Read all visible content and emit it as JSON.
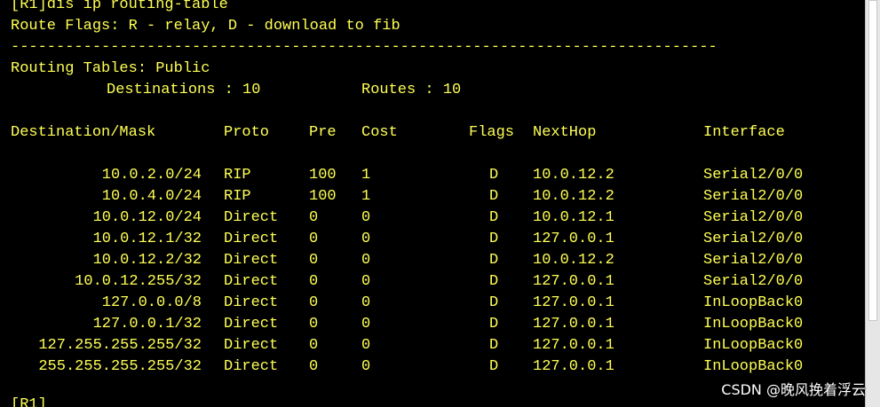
{
  "terminal": {
    "command_line": "[R1]dis ip routing-table",
    "flags_line": "Route Flags: R - relay, D - download to fib",
    "separator": "------------------------------------------------------------------------------",
    "table_name": "Routing Tables: Public",
    "destinations_label": "Destinations : 10",
    "routes_label": "Routes : 10",
    "headers": {
      "dest": "Destination/Mask",
      "proto": "Proto",
      "pre": "Pre",
      "cost": "Cost",
      "flags": "Flags",
      "nexthop": "NextHop",
      "iface": "Interface"
    },
    "rows": [
      {
        "dest": "10.0.2.0/24",
        "proto": "RIP",
        "pre": "100",
        "cost": "1",
        "flags": "D",
        "nexthop": "10.0.12.2",
        "iface": "Serial2/0/0"
      },
      {
        "dest": "10.0.4.0/24",
        "proto": "RIP",
        "pre": "100",
        "cost": "1",
        "flags": "D",
        "nexthop": "10.0.12.2",
        "iface": "Serial2/0/0"
      },
      {
        "dest": "10.0.12.0/24",
        "proto": "Direct",
        "pre": "0",
        "cost": "0",
        "flags": "D",
        "nexthop": "10.0.12.1",
        "iface": "Serial2/0/0"
      },
      {
        "dest": "10.0.12.1/32",
        "proto": "Direct",
        "pre": "0",
        "cost": "0",
        "flags": "D",
        "nexthop": "127.0.0.1",
        "iface": "Serial2/0/0"
      },
      {
        "dest": "10.0.12.2/32",
        "proto": "Direct",
        "pre": "0",
        "cost": "0",
        "flags": "D",
        "nexthop": "10.0.12.2",
        "iface": "Serial2/0/0"
      },
      {
        "dest": "10.0.12.255/32",
        "proto": "Direct",
        "pre": "0",
        "cost": "0",
        "flags": "D",
        "nexthop": "127.0.0.1",
        "iface": "Serial2/0/0"
      },
      {
        "dest": "127.0.0.0/8",
        "proto": "Direct",
        "pre": "0",
        "cost": "0",
        "flags": "D",
        "nexthop": "127.0.0.1",
        "iface": "InLoopBack0"
      },
      {
        "dest": "127.0.0.1/32",
        "proto": "Direct",
        "pre": "0",
        "cost": "0",
        "flags": "D",
        "nexthop": "127.0.0.1",
        "iface": "InLoopBack0"
      },
      {
        "dest": "127.255.255.255/32",
        "proto": "Direct",
        "pre": "0",
        "cost": "0",
        "flags": "D",
        "nexthop": "127.0.0.1",
        "iface": "InLoopBack0"
      },
      {
        "dest": "255.255.255.255/32",
        "proto": "Direct",
        "pre": "0",
        "cost": "0",
        "flags": "D",
        "nexthop": "127.0.0.1",
        "iface": "InLoopBack0"
      }
    ],
    "prompt_partial": "[R1]",
    "text_color": "#ffff55",
    "background_color": "#000000"
  },
  "watermark": "CSDN @晚风挽着浮云"
}
